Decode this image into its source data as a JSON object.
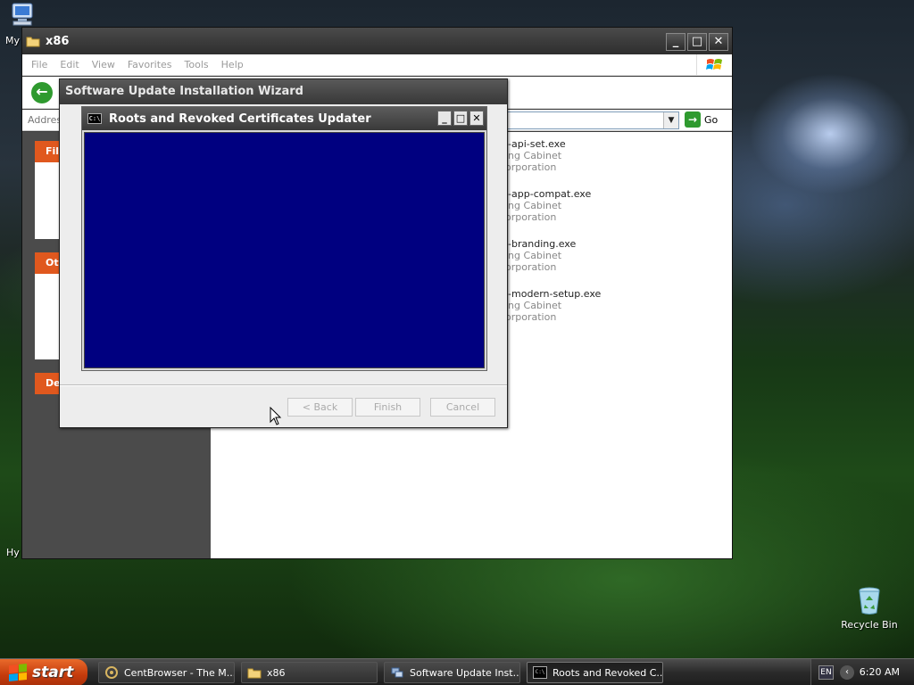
{
  "desktop": {
    "icons": [
      {
        "label": "Recycle Bin",
        "icon": "recycle-bin-icon"
      }
    ],
    "partial_labels": [
      "My",
      "Hy"
    ]
  },
  "explorer": {
    "title": "x86",
    "menu": [
      "File",
      "Edit",
      "View",
      "Favorites",
      "Tools",
      "Help"
    ],
    "address_label": "Addres",
    "go_label": "Go",
    "task_heads": [
      "File",
      "Ot",
      "De"
    ],
    "files": [
      {
        "name": "i-api-set.exe",
        "type": "ing Cabinet",
        "company": "orporation"
      },
      {
        "name": "i-app-compat.exe",
        "type": "ing Cabinet",
        "company": "orporation"
      },
      {
        "name": "i-branding.exe",
        "type": "ing Cabinet",
        "company": "orporation"
      },
      {
        "name": "i-modern-setup.exe",
        "type": "ing Cabinet",
        "company": "orporation"
      }
    ]
  },
  "wizard": {
    "title": "Software Update Installation Wizard",
    "buttons": {
      "back": "< Back",
      "finish": "Finish",
      "cancel": "Cancel"
    }
  },
  "console": {
    "title": "Roots and Revoked Certificates Updater",
    "icon_text": "C:\\",
    "bg_color": "#000080"
  },
  "taskbar": {
    "start_label": "start",
    "items": [
      {
        "label": "CentBrowser - The M...",
        "icon": "browser-icon"
      },
      {
        "label": "x86",
        "icon": "folder-icon"
      },
      {
        "label": "Software Update Inst...",
        "icon": "installer-icon"
      },
      {
        "label": "Roots and Revoked C...",
        "icon": "console-icon",
        "active": true
      }
    ],
    "language": "EN",
    "clock": "6:20 AM"
  }
}
